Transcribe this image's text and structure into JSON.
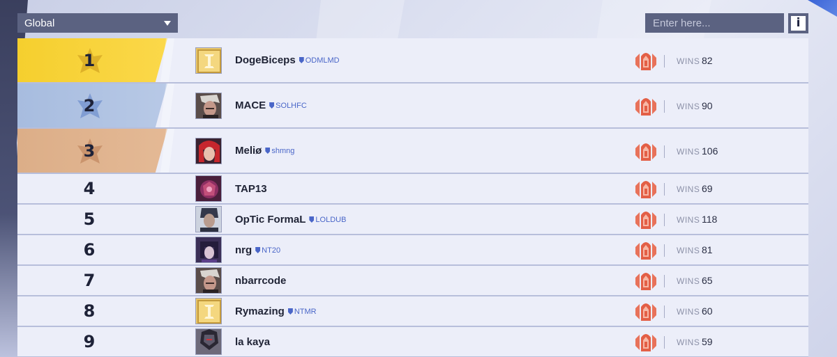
{
  "filter": {
    "selected": "Global"
  },
  "search": {
    "placeholder": "Enter here..."
  },
  "info": {
    "label": "i"
  },
  "wins_label": "WINS",
  "colors": {
    "gold": "#f5cf2e",
    "silver": "#a7bcdf",
    "bronze": "#dcae88",
    "accent": "#4a66c8",
    "rank_icon": "#e8725a"
  },
  "players": [
    {
      "rank": "1",
      "name": "DogeBiceps",
      "tag": "ODMLMD",
      "wins": "82",
      "avatar": "gold-emblem"
    },
    {
      "rank": "2",
      "name": "MACE",
      "tag": "SOLHFC",
      "wins": "90",
      "avatar": "hero-grey"
    },
    {
      "rank": "3",
      "name": "Meliø",
      "tag": "shmng",
      "wins": "106",
      "avatar": "hero-red"
    },
    {
      "rank": "4",
      "name": "TAP13",
      "tag": "",
      "wins": "69",
      "avatar": "hero-purple"
    },
    {
      "rank": "5",
      "name": "OpTic FormaL",
      "tag": "LOLDUB",
      "wins": "118",
      "avatar": "hero-dark"
    },
    {
      "rank": "6",
      "name": "nrg",
      "tag": "NT20",
      "wins": "81",
      "avatar": "hero-violet"
    },
    {
      "rank": "7",
      "name": "nbarrcode",
      "tag": "",
      "wins": "65",
      "avatar": "hero-grey"
    },
    {
      "rank": "8",
      "name": "Rymazing",
      "tag": "NTMR",
      "wins": "60",
      "avatar": "gold-emblem"
    },
    {
      "rank": "9",
      "name": "la kaya",
      "tag": "",
      "wins": "59",
      "avatar": "hero-armor"
    }
  ]
}
